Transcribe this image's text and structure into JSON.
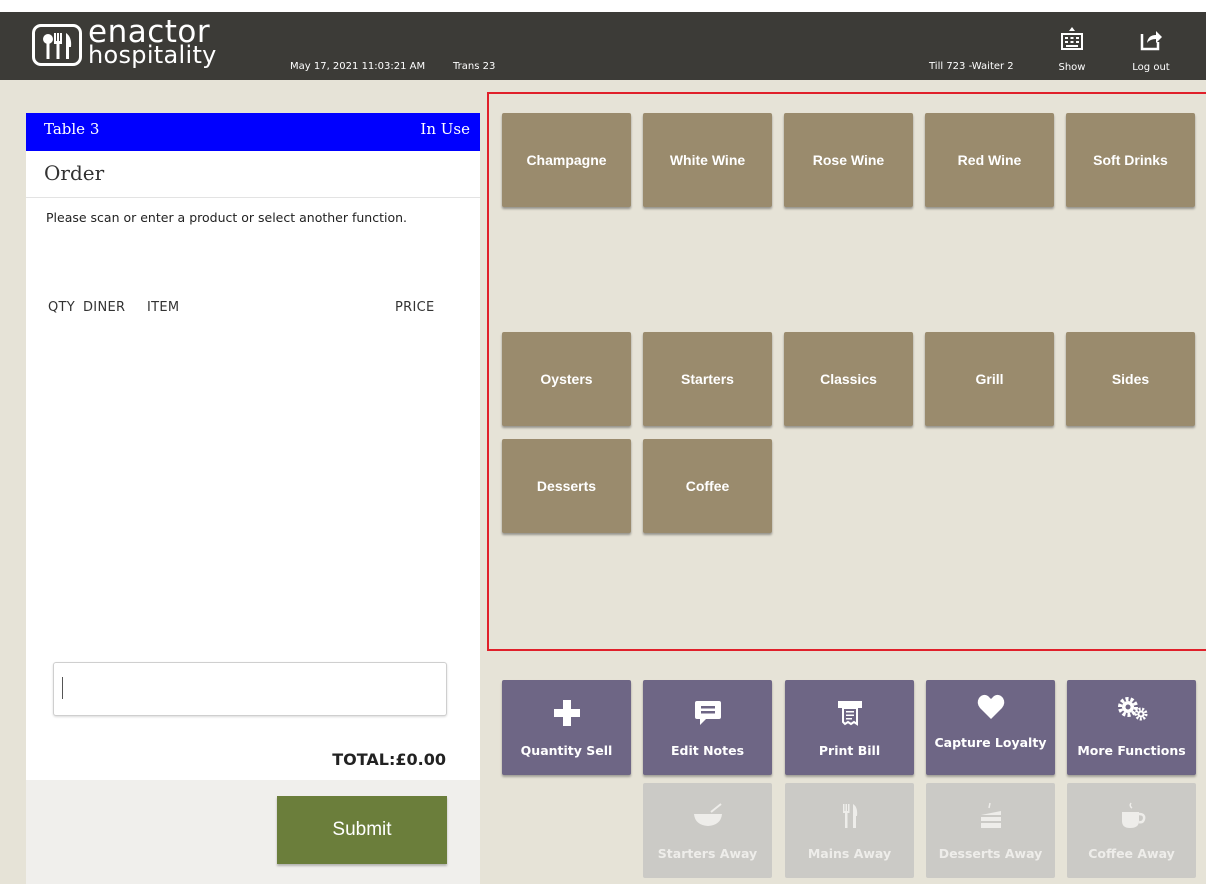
{
  "header": {
    "logo_line1": "enactor",
    "logo_line2": "hospitality",
    "datetime": "May 17, 2021 11:03:21 AM",
    "transaction": "Trans 23",
    "till_info": "Till 723 -Waiter 2",
    "show_label": "Show",
    "logout_label": "Log out"
  },
  "order": {
    "table_name": "Table 3",
    "table_status": "In Use",
    "title": "Order",
    "prompt": "Please scan or enter a product or select another function.",
    "columns": {
      "qty": "QTY",
      "diner": "DINER",
      "item": "ITEM",
      "price": "PRICE"
    },
    "input_value": "",
    "total": "TOTAL:£0.00",
    "submit_label": "Submit"
  },
  "menu": {
    "categories": [
      "Champagne",
      "White Wine",
      "Rose Wine",
      "Red Wine",
      "Soft Drinks",
      "Oysters",
      "Starters",
      "Classics",
      "Grill",
      "Sides",
      "Desserts",
      "Coffee"
    ]
  },
  "functions": {
    "active": [
      "Quantity Sell",
      "Edit Notes",
      "Print Bill",
      "Capture Loyalty",
      "More Functions"
    ],
    "course_away": [
      "Starters Away",
      "Mains Away",
      "Desserts Away",
      "Coffee Away"
    ]
  },
  "icons": {
    "logo": "cutlery-icon",
    "show": "keyboard-icon",
    "logout": "logout-icon",
    "quantity_sell": "plus-icon",
    "edit_notes": "note-bubble-icon",
    "print_bill": "receipt-printer-icon",
    "capture_loyalty": "heart-icon",
    "more_functions": "gears-icon",
    "starters_away": "bowl-icon",
    "mains_away": "fork-knife-icon",
    "desserts_away": "cake-icon",
    "coffee_away": "coffee-cup-icon"
  },
  "colors": {
    "header_bg": "#3c3b37",
    "table_bar": "#0000ff",
    "menu_tile": "#9a8b6d",
    "function_tile": "#6e6685",
    "disabled_tile": "#cbcac6",
    "submit": "#6b7e3b",
    "menu_border": "#e0202a"
  }
}
